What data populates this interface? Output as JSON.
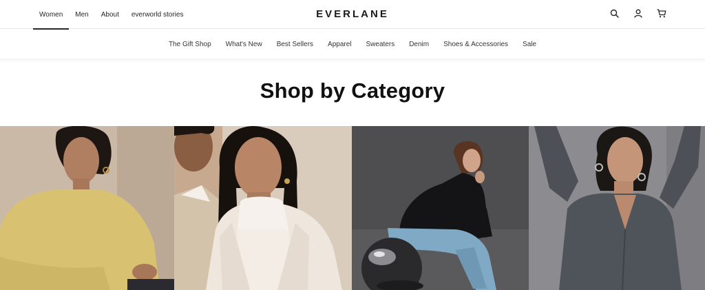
{
  "header": {
    "nav_items": [
      {
        "label": "Women",
        "active": true
      },
      {
        "label": "Men",
        "active": false
      },
      {
        "label": "About",
        "active": false
      },
      {
        "label": "everworld stories",
        "active": false
      }
    ],
    "logo": "EVERLANE",
    "icons": [
      "search-icon",
      "account-icon",
      "cart-icon"
    ]
  },
  "category_nav": [
    "The Gift Shop",
    "What's New",
    "Best Sellers",
    "Apparel",
    "Sweaters",
    "Denim",
    "Shoes & Accessories",
    "Sale"
  ],
  "main": {
    "heading": "Shop by Category",
    "tiles": [
      {
        "subject": "woman in yellow sweater"
      },
      {
        "subject": "woman in cream turtleneck and coat"
      },
      {
        "subject": "woman seated in black sweater and blue jeans"
      },
      {
        "subject": "woman in grey silk shirt"
      }
    ]
  },
  "colors": {
    "text": "#262626",
    "border": "#e6e6e6"
  }
}
